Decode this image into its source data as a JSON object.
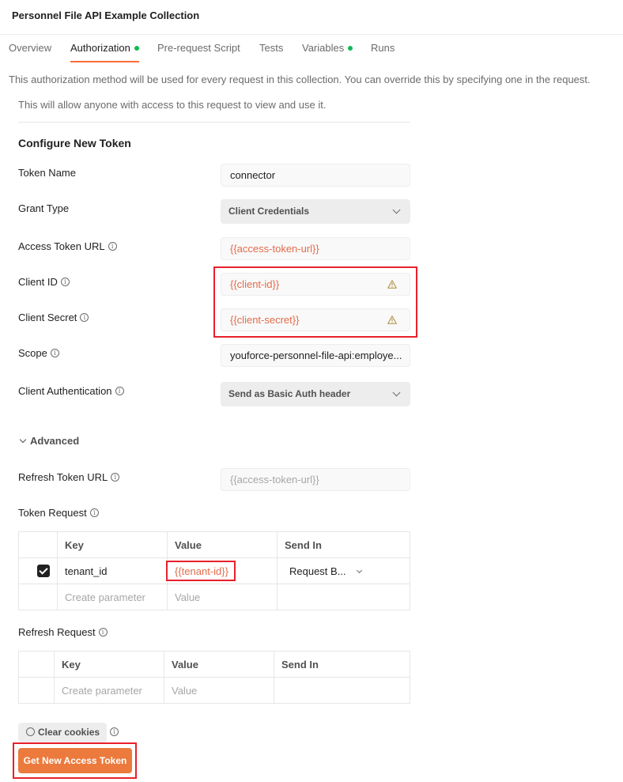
{
  "header": {
    "title": "Personnel File API Example Collection"
  },
  "tabs": [
    {
      "label": "Overview",
      "active": false,
      "dot": false
    },
    {
      "label": "Authorization",
      "active": true,
      "dot": true
    },
    {
      "label": "Pre-request Script",
      "active": false,
      "dot": false
    },
    {
      "label": "Tests",
      "active": false,
      "dot": false
    },
    {
      "label": "Variables",
      "active": false,
      "dot": true
    },
    {
      "label": "Runs",
      "active": false,
      "dot": false
    }
  ],
  "description": "This authorization method will be used for every request in this collection. You can override this by specifying one in the request.",
  "note": "This will allow anyone with access to this request to view and use it.",
  "section_title": "Configure New Token",
  "form": {
    "token_name": {
      "label": "Token Name",
      "value": "connector"
    },
    "grant_type": {
      "label": "Grant Type",
      "value": "Client Credentials"
    },
    "access_token_url": {
      "label": "Access Token URL",
      "value": "{{access-token-url}}"
    },
    "client_id": {
      "label": "Client ID",
      "value": "{{client-id}}"
    },
    "client_secret": {
      "label": "Client Secret",
      "value": "{{client-secret}}"
    },
    "scope": {
      "label": "Scope",
      "value": "youforce-personnel-file-api:employe..."
    },
    "client_authentication": {
      "label": "Client Authentication",
      "value": "Send as Basic Auth header"
    }
  },
  "advanced": {
    "toggle_label": "Advanced",
    "refresh_token_url": {
      "label": "Refresh Token URL",
      "placeholder": "{{access-token-url}}"
    },
    "token_request": {
      "label": "Token Request",
      "headers": [
        "Key",
        "Value",
        "Send In"
      ],
      "rows": [
        {
          "checked": true,
          "key": "tenant_id",
          "value": "{{tenant-id}}",
          "send_in": "Request B..."
        }
      ],
      "new_row": {
        "key_placeholder": "Create parameter",
        "value_placeholder": "Value"
      }
    },
    "refresh_request": {
      "label": "Refresh Request",
      "headers": [
        "Key",
        "Value",
        "Send In"
      ],
      "new_row": {
        "key_placeholder": "Create parameter",
        "value_placeholder": "Value"
      }
    }
  },
  "buttons": {
    "clear_cookies": "Clear cookies",
    "get_new_access_token": "Get New Access Token"
  },
  "icons": {
    "info": "i"
  },
  "colors": {
    "accent": "#ff6c37",
    "primary_button": "#eb7a3c",
    "variable_text": "#e26b4a",
    "status_dot": "#0cbb52",
    "highlight_box": "#e8212c",
    "warning": "#b79a55"
  }
}
